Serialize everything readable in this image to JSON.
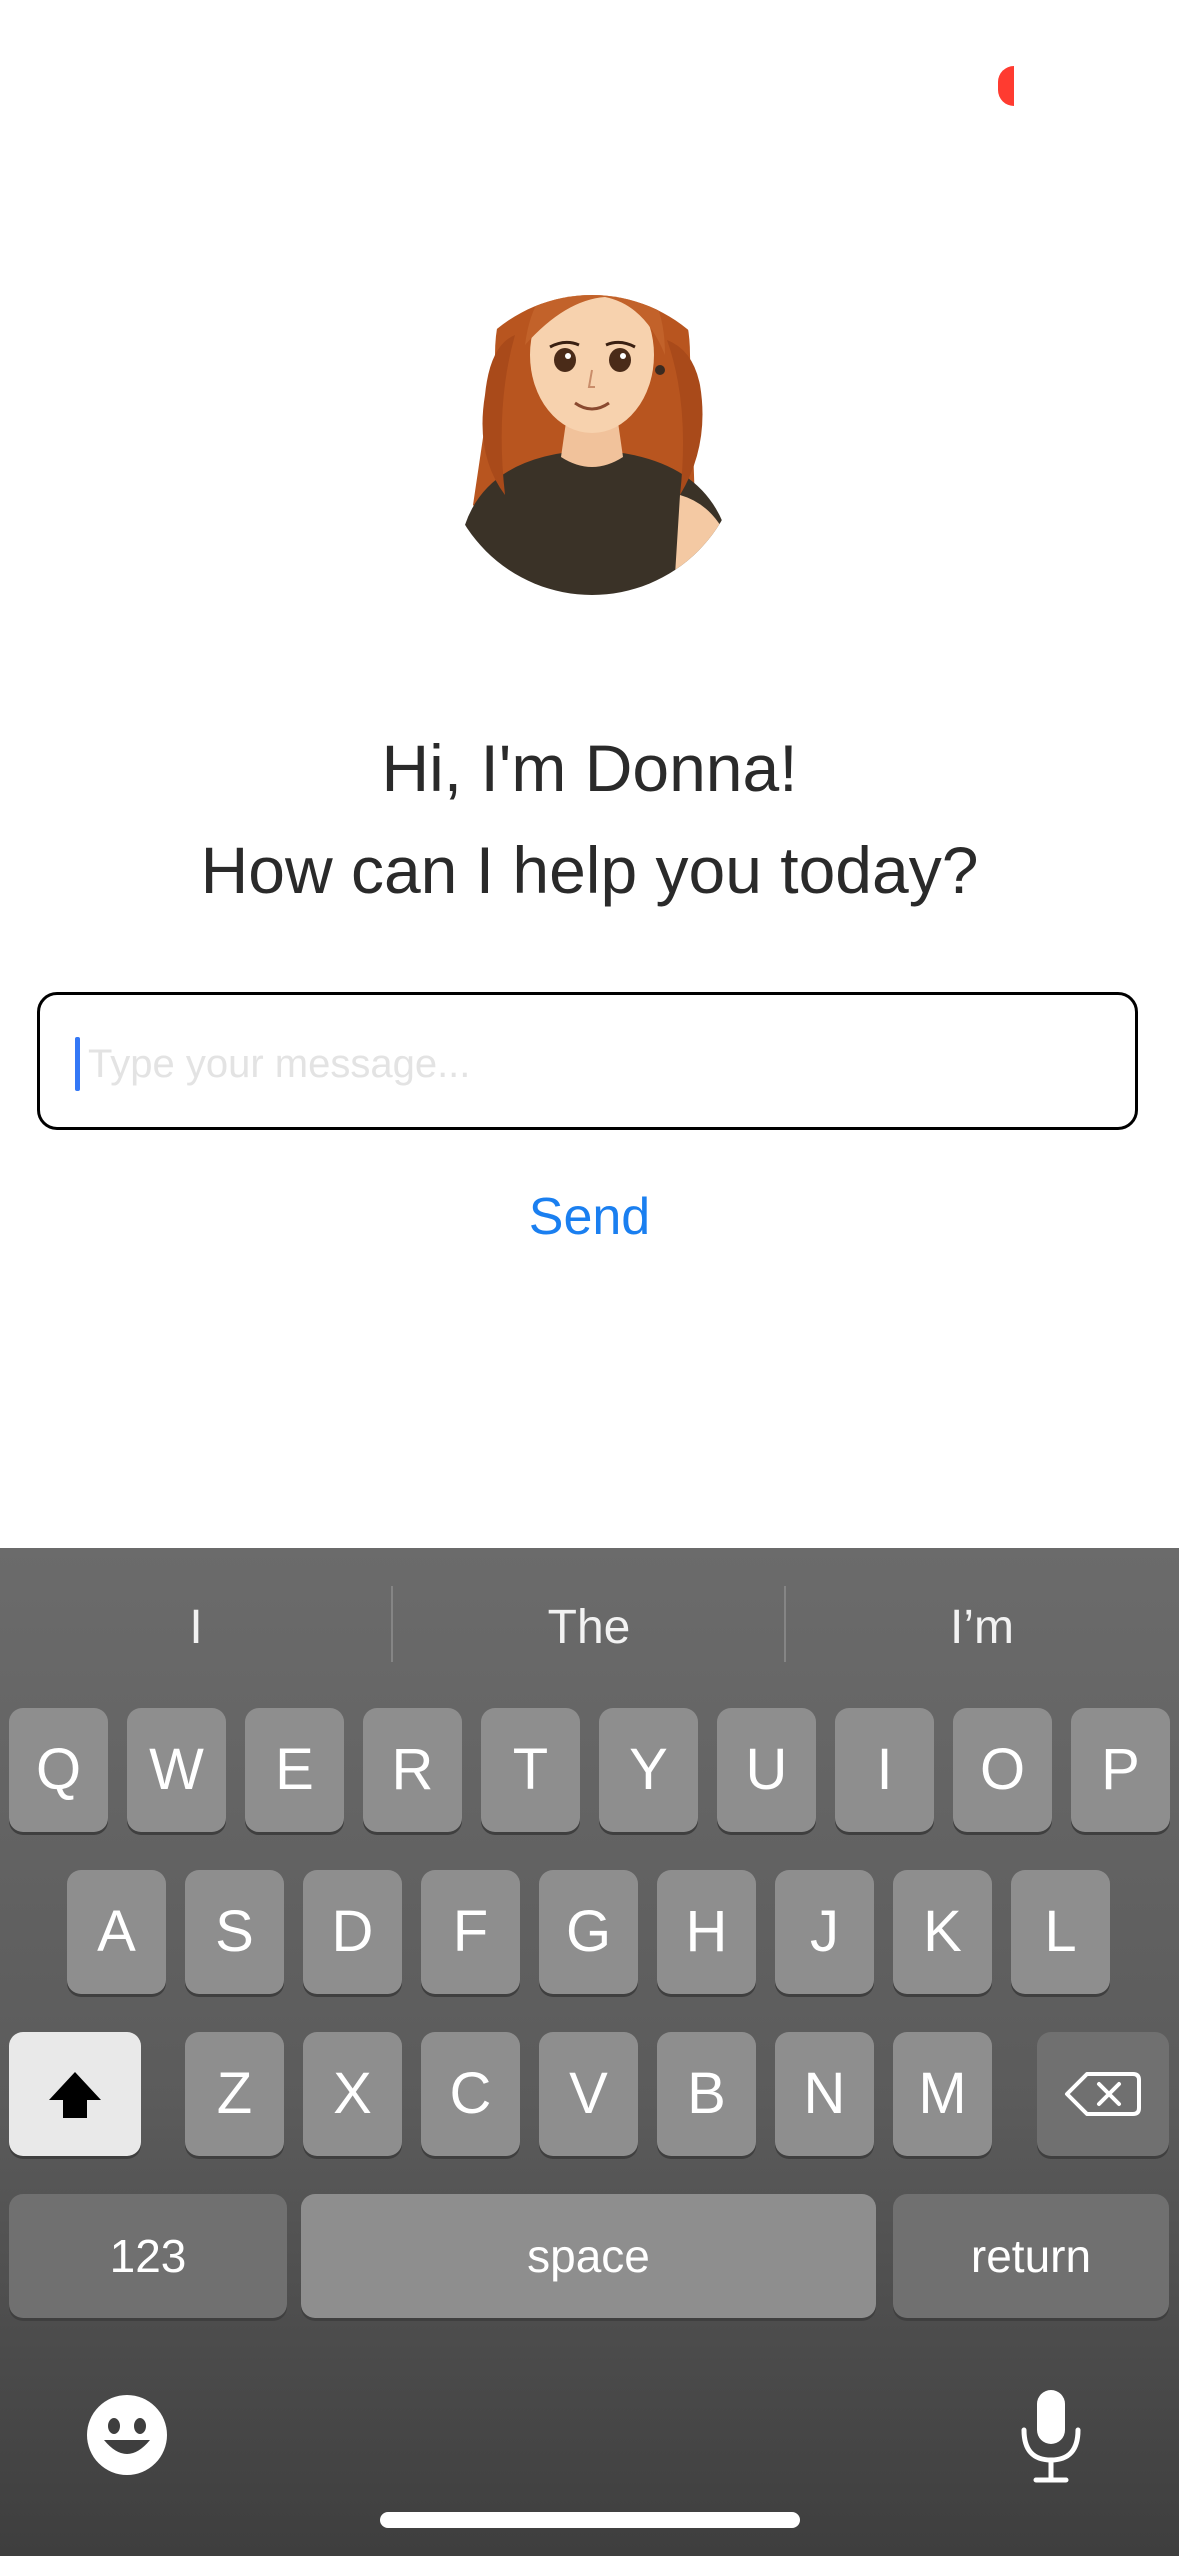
{
  "greeting": {
    "line1": "Hi, I'm Donna!",
    "line2": "How can I help you today?"
  },
  "message": {
    "placeholder": "Type your message...",
    "value": ""
  },
  "send_label": "Send",
  "keyboard": {
    "suggestions": [
      "I",
      "The",
      "I’m"
    ],
    "row1": [
      "Q",
      "W",
      "E",
      "R",
      "T",
      "Y",
      "U",
      "I",
      "O",
      "P"
    ],
    "row2": [
      "A",
      "S",
      "D",
      "F",
      "G",
      "H",
      "J",
      "K",
      "L"
    ],
    "row3": [
      "Z",
      "X",
      "C",
      "V",
      "B",
      "N",
      "M"
    ],
    "numbers_label": "123",
    "space_label": "space",
    "return_label": "return"
  },
  "colors": {
    "accent": "#1a7ff0",
    "caret": "#3478f6",
    "recording_indicator": "#ff3b30"
  },
  "icons": {
    "shift": "shift-icon",
    "delete": "backspace-icon",
    "emoji": "emoji-icon",
    "dictation": "microphone-icon"
  }
}
